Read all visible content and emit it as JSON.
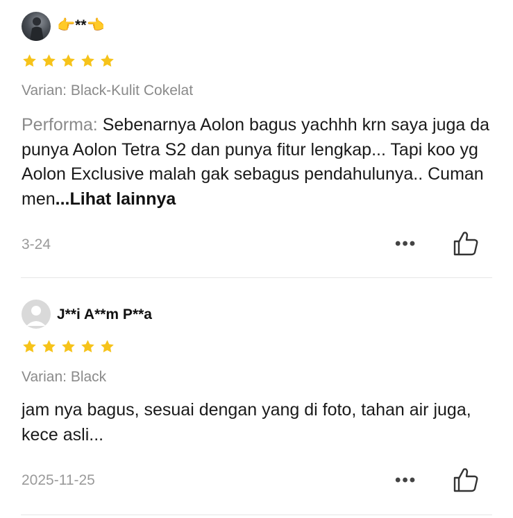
{
  "reviews": [
    {
      "username": "👉**👈",
      "rating": 5,
      "variant": "Varian: Black-Kulit Cokelat",
      "content_label": "Performa:",
      "content_text": " Sebenarnya Aolon bagus yachhh krn saya juga da punya Aolon Tetra S2 dan punya fitur lengkap... Tapi koo yg Aolon Exclusive malah gak sebagus pendahulunya.. Cuman men",
      "more_label": "...Lihat lainnya",
      "date": "3-24",
      "more_menu": "•••",
      "like_icon": "thumbs-up-outline"
    },
    {
      "username": "J**i A**m P**a",
      "rating": 5,
      "variant": "Varian: Black",
      "content_text": "jam nya bagus, sesuai dengan yang di foto, tahan air juga, kece asli...",
      "date": "2025-11-25",
      "more_menu": "•••",
      "like_icon": "thumbs-up-outline"
    }
  ],
  "colors": {
    "star": "#F6C31A",
    "secondary_text": "#8A8A8A",
    "divider": "#E6E6E6"
  }
}
